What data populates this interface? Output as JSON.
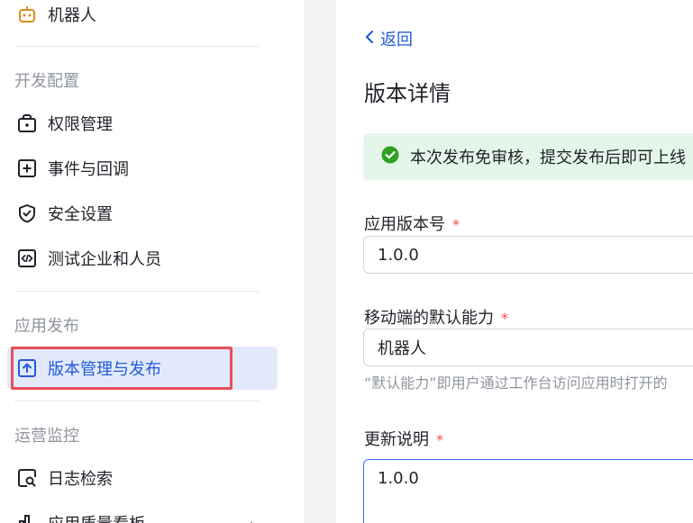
{
  "sidebar": {
    "robot": "机器人",
    "section_dev": "开发配置",
    "permissions": "权限管理",
    "events": "事件与回调",
    "security": "安全设置",
    "test_users": "测试企业和人员",
    "section_publish": "应用发布",
    "version_publish": "版本管理与发布",
    "section_ops": "运营监控",
    "log_search": "日志检索",
    "quality_dashboard": "应用质量看板"
  },
  "main": {
    "back": "返回",
    "title": "版本详情",
    "notice": "本次发布免审核，提交发布后即可上线",
    "version_label": "应用版本号",
    "version_value": "1.0.0",
    "required_mark": "*",
    "mobile_label": "移动端的默认能力",
    "mobile_value": "机器人",
    "mobile_hint": "“默认能力”即用户通过工作台访问应用时打开的",
    "notes_label": "更新说明",
    "notes_value": "1.0.0"
  },
  "colors": {
    "accent": "#245bdb",
    "active_bg": "#e1e9fb",
    "highlight": "#e8505b",
    "success": "#2ea121",
    "notice_bg": "#e4f5e9"
  }
}
